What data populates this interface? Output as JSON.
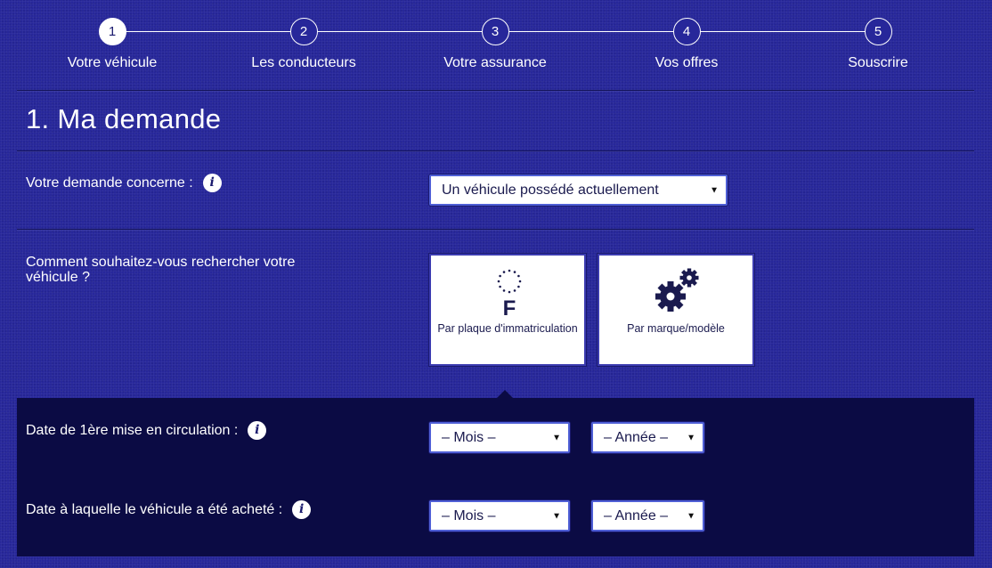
{
  "stepper": {
    "steps": [
      {
        "number": "1",
        "label": "Votre véhicule",
        "active": true
      },
      {
        "number": "2",
        "label": "Les conducteurs",
        "active": false
      },
      {
        "number": "3",
        "label": "Votre assurance",
        "active": false
      },
      {
        "number": "4",
        "label": "Vos offres",
        "active": false
      },
      {
        "number": "5",
        "label": "Souscrire",
        "active": false
      }
    ]
  },
  "section": {
    "title": "1. Ma demande"
  },
  "demande": {
    "label": "Votre demande concerne :",
    "info_icon": "i",
    "selected": "Un véhicule possédé actuellement"
  },
  "recherche": {
    "label": "Comment souhaitez-vous rechercher votre véhicule ?",
    "options": [
      {
        "icon": "license-plate-f-icon",
        "icon_letter": "F",
        "label": "Par plaque d'immatriculation"
      },
      {
        "icon": "gears-icon",
        "label": "Par marque/modèle"
      }
    ]
  },
  "circulation": {
    "label": "Date de 1ère mise en circulation :",
    "info_icon": "i",
    "month_value": "– Mois –",
    "year_value": "– Année –"
  },
  "achat": {
    "label": "Date à laquelle le véhicule a été acheté :",
    "info_icon": "i",
    "month_value": "– Mois –",
    "year_value": "– Année –"
  },
  "colors": {
    "background": "#27279a",
    "dark_panel": "#0b0b44",
    "text_dark": "#1a1a4e",
    "select_border": "#4f5fd6"
  }
}
